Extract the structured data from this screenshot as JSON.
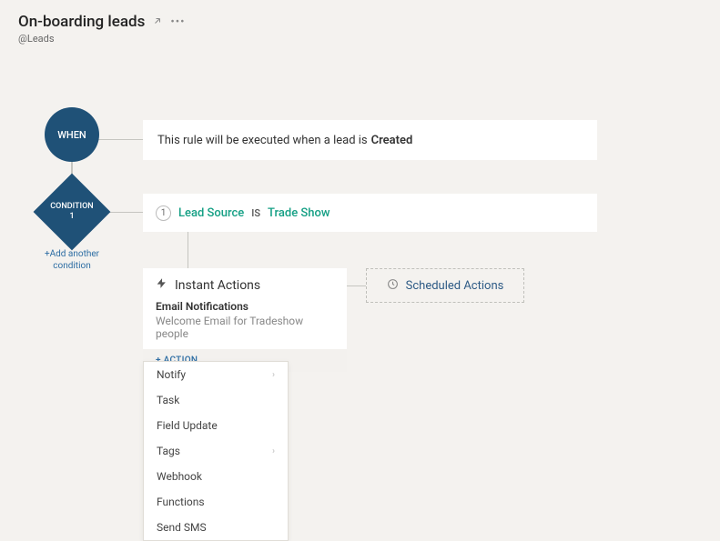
{
  "header": {
    "title": "On-boarding leads",
    "module_prefix": "@",
    "module": "Leads"
  },
  "when": {
    "label": "WHEN",
    "text_prefix": "This rule will be executed when a lead is ",
    "trigger": "Created"
  },
  "condition": {
    "label_top": "CONDITION",
    "label_num": "1",
    "add_text": "+Add another condition",
    "step": "1",
    "field": "Lead Source",
    "op": "IS",
    "value": "Trade Show"
  },
  "instant": {
    "title": "Instant Actions",
    "section": "Email Notifications",
    "desc": "Welcome Email for Tradeshow people",
    "add_action": "+ ACTION"
  },
  "scheduled": {
    "title": "Scheduled Actions"
  },
  "dropdown": {
    "items": [
      {
        "label": "Notify",
        "has_sub": true
      },
      {
        "label": "Task",
        "has_sub": false
      },
      {
        "label": "Field Update",
        "has_sub": false
      },
      {
        "label": "Tags",
        "has_sub": true
      },
      {
        "label": "Webhook",
        "has_sub": false
      },
      {
        "label": "Functions",
        "has_sub": false
      },
      {
        "label": "Send SMS",
        "has_sub": false
      }
    ]
  }
}
